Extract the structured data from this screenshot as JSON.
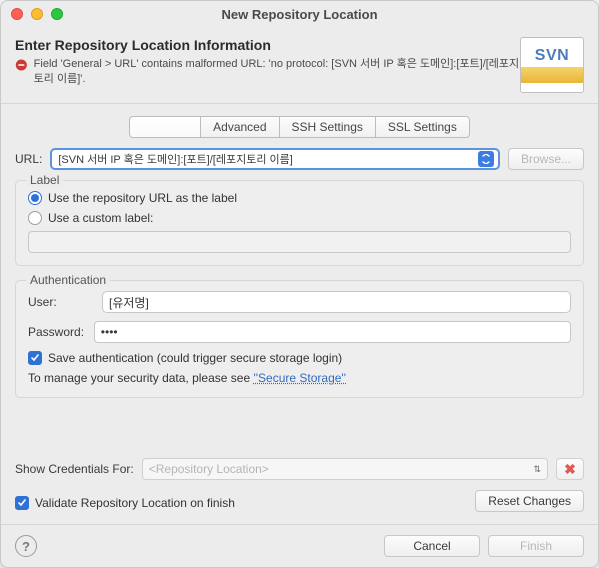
{
  "window": {
    "title": "New Repository Location"
  },
  "header": {
    "title": "Enter Repository Location Information",
    "error": "Field 'General > URL' contains malformed URL: 'no protocol: [SVN 서버 IP 혹은 도메인]:[포트]/[레포지토리 이름]'."
  },
  "logo": {
    "text": "SVN"
  },
  "tabs": {
    "general": "",
    "advanced": "Advanced",
    "ssh": "SSH Settings",
    "ssl": "SSL Settings"
  },
  "url": {
    "label": "URL:",
    "value": "[SVN 서버 IP 혹은 도메인]:[포트]/[레포지토리 이름]",
    "browse": "Browse..."
  },
  "labelGroup": {
    "legend": "Label",
    "radio1": "Use the repository URL as the label",
    "radio2": "Use a custom label:",
    "customValue": ""
  },
  "auth": {
    "legend": "Authentication",
    "userLabel": "User:",
    "userValue": "[유저명]",
    "passwordLabel": "Password:",
    "passwordValue": "••••",
    "saveAuth": "Save authentication (could trigger secure storage login)",
    "manageText": "To manage your security data, please see ",
    "manageLink": "''Secure Storage''"
  },
  "credentials": {
    "label": "Show Credentials For:",
    "placeholder": "<Repository Location>"
  },
  "validate": {
    "label": "Validate Repository Location on finish",
    "reset": "Reset Changes"
  },
  "footer": {
    "cancel": "Cancel",
    "finish": "Finish"
  }
}
